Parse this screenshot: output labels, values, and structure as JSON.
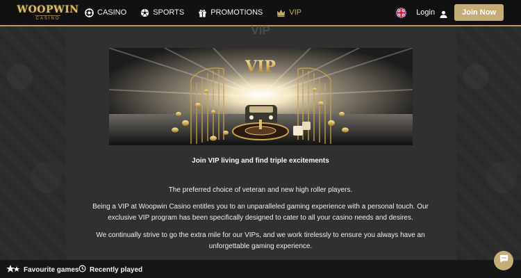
{
  "header": {
    "logo": {
      "main": "WOOPWIN",
      "sub": "CASINO"
    },
    "nav": [
      {
        "label": "CASINO",
        "icon": "chip-icon"
      },
      {
        "label": "SPORTS",
        "icon": "soccer-ball-icon"
      },
      {
        "label": "PROMOTIONS",
        "icon": "gift-icon"
      },
      {
        "label": "VIP",
        "icon": "crown-icon",
        "active": true
      }
    ],
    "language_icon": "uk-flag-icon",
    "login_label": "Login",
    "join_label": "Join Now"
  },
  "page": {
    "title": "VIP",
    "banner_text": "VIP",
    "caption": "Join VIP living and find triple excitements",
    "paragraphs": [
      [
        "The preferred choice of veteran and new high roller players."
      ],
      [
        "Being a VIP at Woopwin Casino entitles you to an unparalleled gaming experience with a personal touch. Our",
        "exclusive VIP program has been specifically designed to cater to all your casino needs and desires."
      ],
      [
        "We continually strive to go the extra mile for our VIPs, and we work tirelessly to ensure you always have an",
        "unforgettable gaming experience."
      ]
    ]
  },
  "bottom_bar": {
    "favourites_label": "Favourite games",
    "recent_label": "Recently played"
  },
  "colors": {
    "accent": "#c4ad76",
    "header_bg": "#111111",
    "page_bg": "#303030",
    "gold": "#d8bb6a"
  }
}
